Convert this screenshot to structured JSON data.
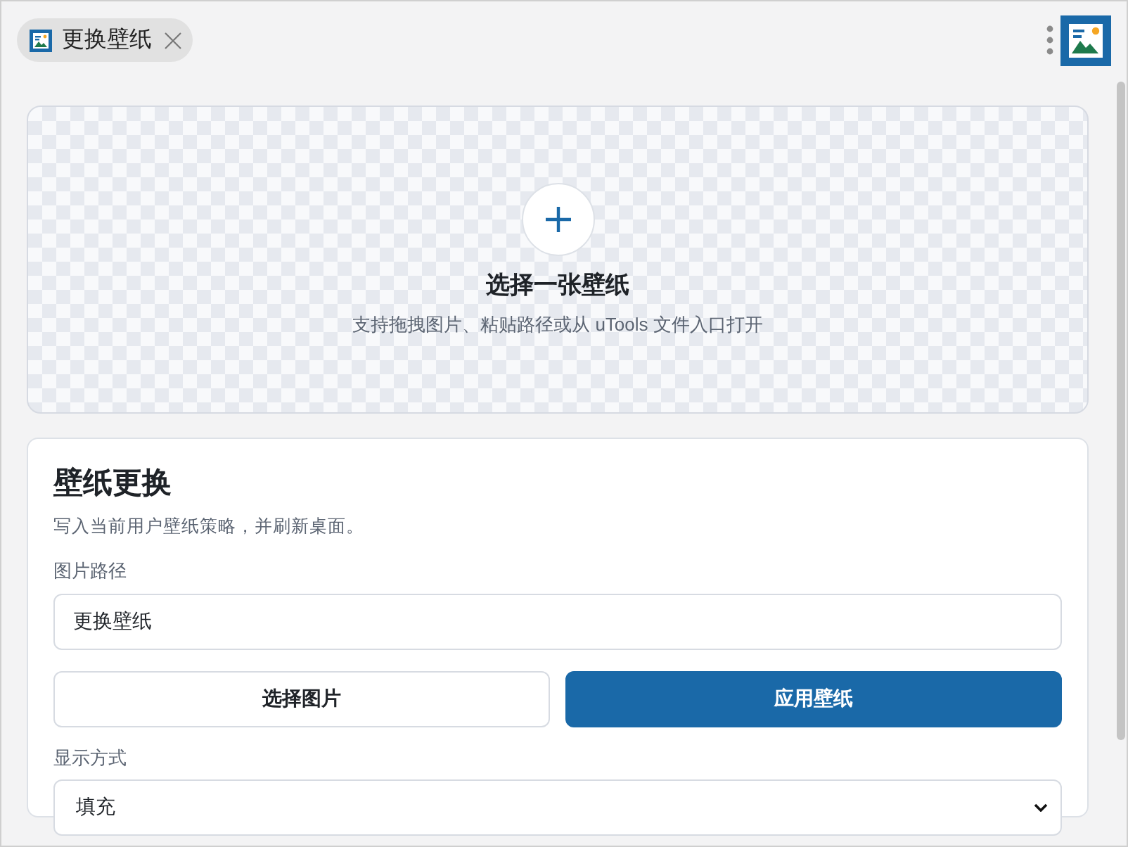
{
  "tab": {
    "title": "更换壁纸"
  },
  "dropzone": {
    "title": "选择一张壁纸",
    "hint": "支持拖拽图片、粘贴路径或从 uTools 文件入口打开"
  },
  "card": {
    "title": "壁纸更换",
    "description": "写入当前用户壁纸策略，并刷新桌面。",
    "path_field": {
      "label": "图片路径",
      "value": "更换壁纸"
    },
    "buttons": [
      {
        "label": "选择图片",
        "primary": false
      },
      {
        "label": "应用壁纸",
        "primary": true
      }
    ],
    "display_field": {
      "label": "显示方式",
      "value": "填充"
    }
  }
}
